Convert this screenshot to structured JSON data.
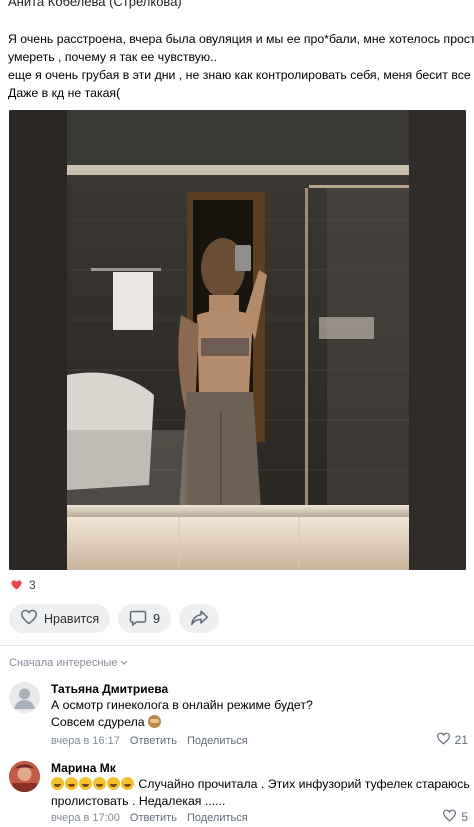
{
  "post": {
    "author": "Анита Кобелева (Стрелкова)",
    "text_lines": [
      "Я очень расстроена, вчера была овуляция и мы ее про*бали, мне хотелось просто",
      "умереть , почему я так ее чувствую..",
      "еще я очень грубая в эти дни , не знаю как контролировать себя, меня бесит все .",
      "Даже в кд не такая("
    ],
    "reactions_count": "3",
    "like_label": "Нравится",
    "comments_count": "9"
  },
  "comments_section": {
    "sort_label": "Сначала интересные"
  },
  "comments": [
    {
      "name": "Татьяна Дмитриева",
      "line1": "А осмотр гинеколога в онлайн режиме будет?",
      "line2": "Совсем сдурела",
      "time": "вчера в 16:17",
      "reply": "Ответить",
      "share": "Поделиться",
      "likes": "21"
    },
    {
      "name": "Марина Мк",
      "line1": "Случайно прочитала . Этих инфузорий туфелек стараюсь",
      "line2": "пролистовать . Недалекая ......",
      "time": "вчера в 17:00",
      "reply": "Ответить",
      "share": "Поделиться",
      "likes": "5"
    }
  ],
  "icons": {
    "heart": "heart-icon",
    "comment": "comment-icon",
    "share": "share-icon",
    "chevron": "chevron-down-icon"
  },
  "colors": {
    "accent_red": "#e64646",
    "muted": "#818c99",
    "pill_bg": "#eeeff1"
  }
}
